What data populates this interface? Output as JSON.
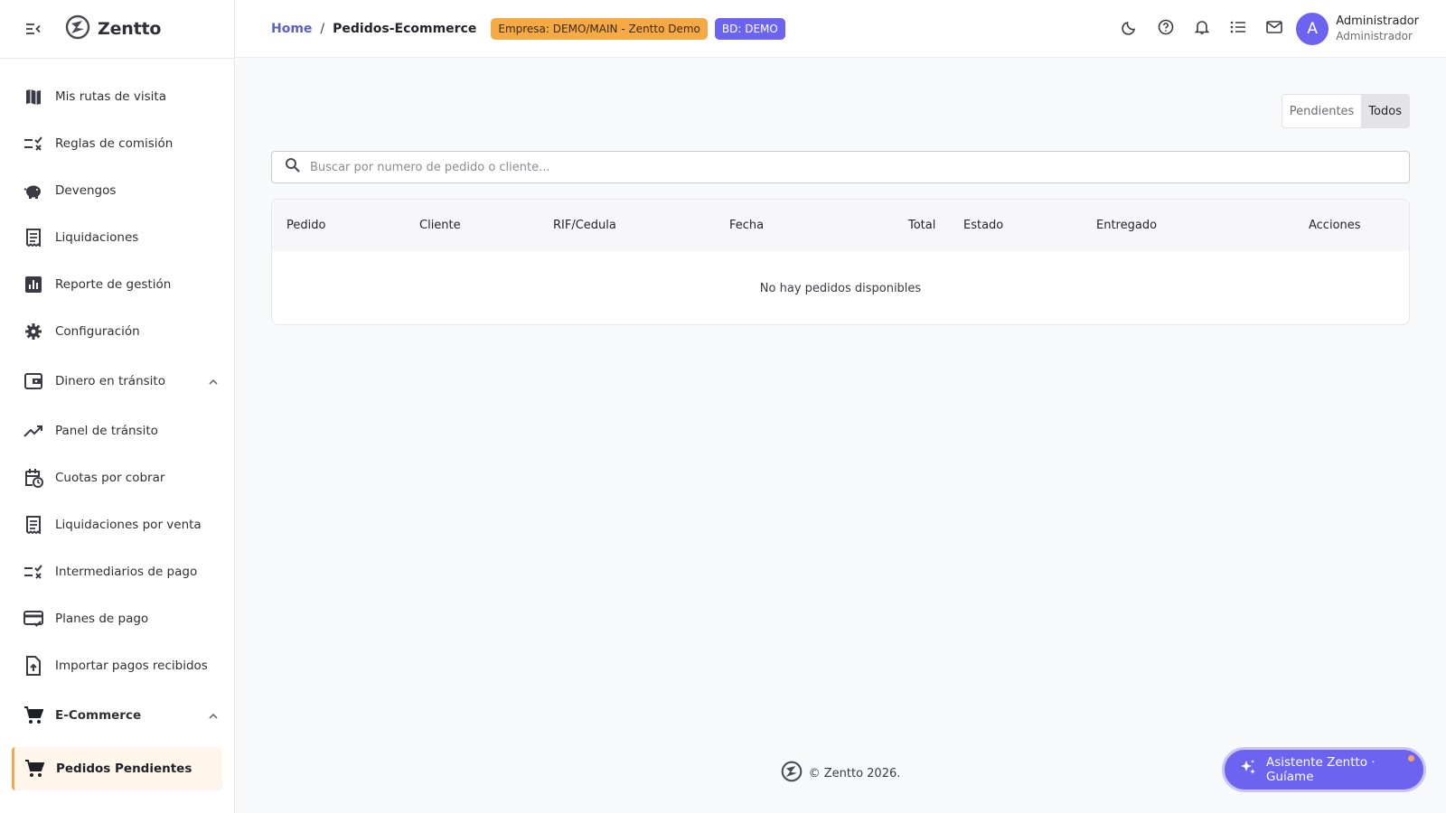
{
  "brand": {
    "name": "Zentto",
    "logo_icon": "zentto-logo-icon"
  },
  "sidebar": {
    "items": [
      {
        "label": "Mis rutas de visita",
        "icon": "map-icon"
      },
      {
        "label": "Reglas de comisión",
        "icon": "rule-check-icon"
      },
      {
        "label": "Devengos",
        "icon": "piggy-bank-icon"
      },
      {
        "label": "Liquidaciones",
        "icon": "receipt-icon"
      },
      {
        "label": "Reporte de gestión",
        "icon": "bar-chart-icon"
      },
      {
        "label": "Configuración",
        "icon": "gear-icon"
      },
      {
        "label": "Dinero en tránsito",
        "icon": "wallet-icon",
        "expanded": true
      },
      {
        "label": "Panel de tránsito",
        "icon": "trending-up-icon"
      },
      {
        "label": "Cuotas por cobrar",
        "icon": "calendar-clock-icon"
      },
      {
        "label": "Liquidaciones por venta",
        "icon": "receipt-icon"
      },
      {
        "label": "Intermediarios de pago",
        "icon": "rule-check-icon"
      },
      {
        "label": "Planes de pago",
        "icon": "credit-card-icon"
      },
      {
        "label": "Importar pagos recibidos",
        "icon": "file-upload-icon"
      },
      {
        "label": "E-Commerce",
        "icon": "cart-icon",
        "expanded": true
      },
      {
        "label": "Pedidos Pendientes",
        "icon": "cart-icon",
        "active": true
      }
    ]
  },
  "topbar": {
    "breadcrumb": {
      "home": "Home",
      "separator": "/",
      "current": "Pedidos-Ecommerce"
    },
    "badges": {
      "empresa": "Empresa: DEMO/MAIN - Zentto Demo",
      "bd": "BD: DEMO"
    },
    "icons": [
      "moon-icon",
      "help-icon",
      "bell-icon",
      "list-icon",
      "mail-icon"
    ],
    "user": {
      "initial": "A",
      "name": "Administrador",
      "role": "Administrador"
    }
  },
  "filters": {
    "pendientes": "Pendientes",
    "todos": "Todos",
    "selected": "Todos"
  },
  "search": {
    "placeholder": "Buscar por numero de pedido o cliente...",
    "value": ""
  },
  "table": {
    "columns": [
      "Pedido",
      "Cliente",
      "RIF/Cedula",
      "Fecha",
      "Total",
      "Estado",
      "Entregado",
      "Acciones"
    ],
    "rows": [],
    "empty_message": "No hay pedidos disponibles"
  },
  "footer": {
    "text": "© Zentto 2026."
  },
  "assistant": {
    "label": "Asistente Zentto · Guíame",
    "icon": "sparkle-icon"
  },
  "colors": {
    "accent": "#6c63f0",
    "warning": "#f6aa45",
    "active_bg": "#fff6eb",
    "active_border": "#f5a54a"
  }
}
